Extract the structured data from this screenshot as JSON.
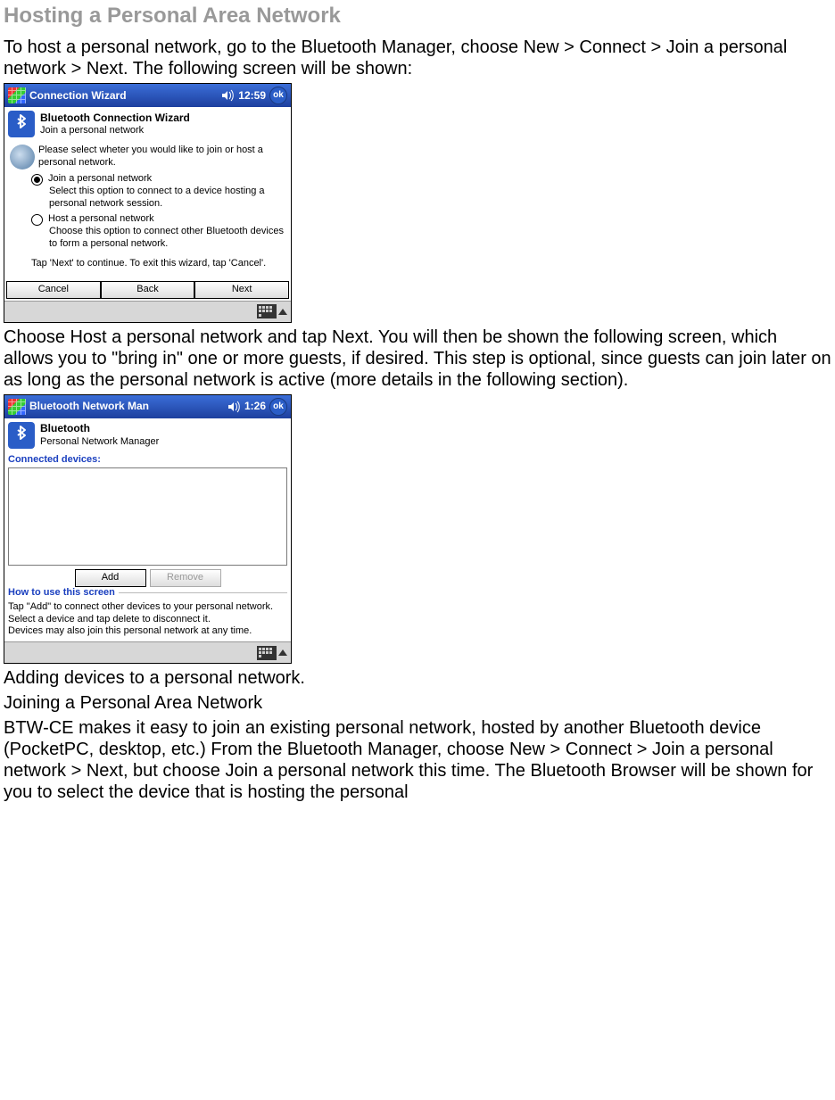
{
  "heading": "Hosting a Personal Area Network",
  "para1": "To host a personal network, go to the Bluetooth Manager, choose New > Connect > Join a personal network > Next. The following screen will be shown:",
  "shot1": {
    "title": "Connection Wizard",
    "clock": "12:59",
    "ok": "ok",
    "headerBold": "Bluetooth Connection Wizard",
    "headerSub": "Join a personal network",
    "prompt": "Please select wheter you would like to join or host a personal network.",
    "opt1_label": "Join a personal network",
    "opt1_desc": "Select this option to connect to a device hosting a personal network session.",
    "opt2_label": "Host a personal network",
    "opt2_desc": "Choose this option to connect other Bluetooth devices to form a personal network.",
    "hint": "Tap 'Next' to continue. To exit this wizard, tap 'Cancel'.",
    "btn_cancel": "Cancel",
    "btn_back": "Back",
    "btn_next": "Next"
  },
  "para2": "Choose Host a personal network and tap Next. You will then be shown the following screen, which allows you to \"bring in\" one or more guests, if desired. This step is optional, since guests can join later on as long as the personal network is active (more details in the following section).",
  "shot2": {
    "title": "Bluetooth Network Man",
    "clock": "1:26",
    "ok": "ok",
    "headerBold": "Bluetooth",
    "headerSub": "Personal Network Manager",
    "connectedLabel": "Connected devices:",
    "btn_add": "Add",
    "btn_remove": "Remove",
    "help_title": "How to use this screen",
    "help_text1": "Tap \"Add\" to connect other devices to your personal network. Select a device and tap delete to disconnect it.",
    "help_text2": "Devices may also join this personal network at any time."
  },
  "caption2": "Adding devices to a personal network.",
  "sub2": "Joining a Personal Area Network",
  "para3": "BTW-CE makes it easy to join an existing personal network, hosted by another Bluetooth device (PocketPC, desktop, etc.) From the Bluetooth Manager, choose New > Connect > Join a personal network > Next, but choose Join a personal network this time. The Bluetooth Browser will be shown for you to select the device that is hosting the personal"
}
